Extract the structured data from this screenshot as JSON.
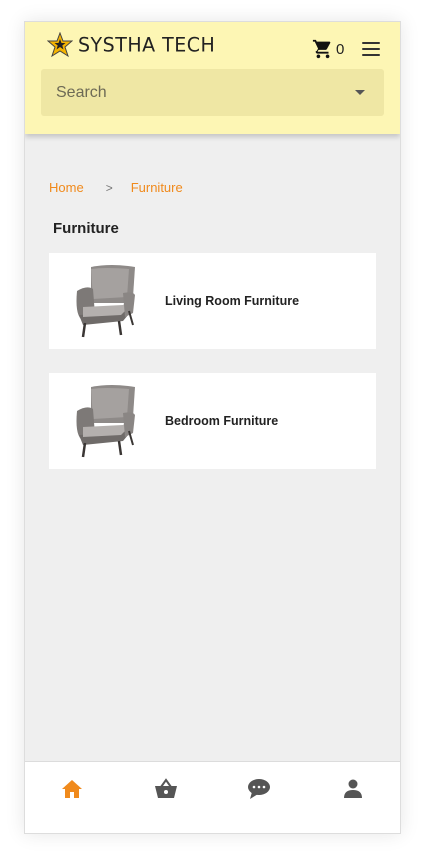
{
  "header": {
    "logo_text": "SYSTHA TECH",
    "cart_count": "0",
    "search_placeholder": "Search"
  },
  "breadcrumb": {
    "home": "Home",
    "separator": ">",
    "current": "Furniture"
  },
  "page": {
    "title": "Furniture"
  },
  "categories": [
    {
      "label": "Living Room Furniture",
      "icon": "armchair-image"
    },
    {
      "label": "Bedroom Furniture",
      "icon": "armchair-image"
    }
  ],
  "bottom_nav": [
    {
      "name": "home",
      "icon": "home-icon",
      "active": true
    },
    {
      "name": "shop",
      "icon": "basket-icon",
      "active": false
    },
    {
      "name": "chat",
      "icon": "chat-icon",
      "active": false
    },
    {
      "name": "account",
      "icon": "user-icon",
      "active": false
    }
  ],
  "colors": {
    "header_bg": "#fdf6b4",
    "search_bg": "#efe7a4",
    "accent": "#f08a1c",
    "page_bg": "#efefef"
  }
}
